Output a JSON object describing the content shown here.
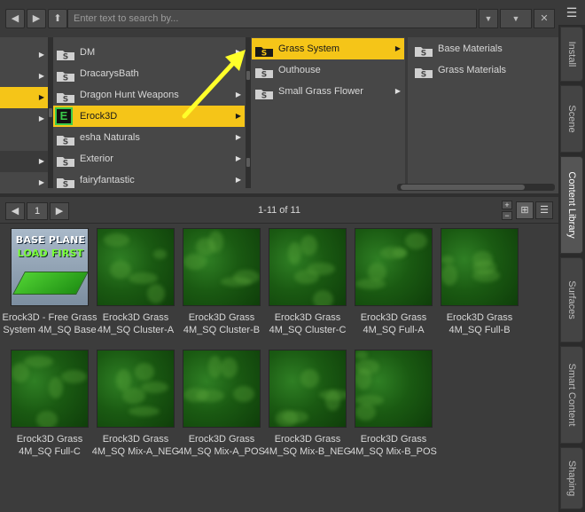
{
  "toolbar": {
    "back_icon": "arrow-left-icon",
    "forward_icon": "arrow-right-icon",
    "up_icon": "arrow-up-icon",
    "search_placeholder": "Enter text to search by...",
    "dropdown_icon": "chevron-down-icon",
    "clear_icon": "close-icon"
  },
  "browser": {
    "column2": [
      {
        "label": "DM",
        "has_children": true,
        "selected": false
      },
      {
        "label": "DracarysBath",
        "has_children": false,
        "selected": false
      },
      {
        "label": "Dragon Hunt Weapons",
        "has_children": true,
        "selected": false
      },
      {
        "label": "Erock3D",
        "has_children": true,
        "selected": true
      },
      {
        "label": "esha Naturals",
        "has_children": true,
        "selected": false
      },
      {
        "label": "Exterior",
        "has_children": true,
        "selected": false
      },
      {
        "label": "fairyfantastic",
        "has_children": true,
        "selected": false
      }
    ],
    "column3": [
      {
        "label": "Grass System",
        "has_children": true,
        "selected": true
      },
      {
        "label": "Outhouse",
        "has_children": false,
        "selected": false
      },
      {
        "label": "Small Grass Flower",
        "has_children": true,
        "selected": false
      }
    ],
    "column4": [
      {
        "label": "Base Materials"
      },
      {
        "label": "Grass Materials"
      }
    ]
  },
  "pager": {
    "page": "1",
    "count_text": "1-11 of 11"
  },
  "thumbnails": [
    {
      "label": "Erock3D - Free Grass System 4M_SQ Base",
      "kind": "base",
      "base_title": "BASE PLANE",
      "base_subtitle": "LOAD FIRST"
    },
    {
      "label": "Erock3D Grass 4M_SQ Cluster-A",
      "kind": "grass"
    },
    {
      "label": "Erock3D Grass 4M_SQ Cluster-B",
      "kind": "grass"
    },
    {
      "label": "Erock3D Grass 4M_SQ Cluster-C",
      "kind": "grass"
    },
    {
      "label": "Erock3D Grass 4M_SQ Full-A",
      "kind": "grass"
    },
    {
      "label": "Erock3D Grass 4M_SQ Full-B",
      "kind": "grass"
    },
    {
      "label": "Erock3D Grass 4M_SQ Full-C",
      "kind": "grass"
    },
    {
      "label": "Erock3D Grass 4M_SQ Mix-A_NEG",
      "kind": "grass"
    },
    {
      "label": "Erock3D Grass 4M_SQ Mix-A_POS",
      "kind": "grass"
    },
    {
      "label": "Erock3D Grass 4M_SQ Mix-B_NEG",
      "kind": "grass"
    },
    {
      "label": "Erock3D Grass 4M_SQ Mix-B_POS",
      "kind": "grass"
    }
  ],
  "side_tabs": [
    {
      "label": "Install",
      "active": false
    },
    {
      "label": "Scene",
      "active": false
    },
    {
      "label": "Content Library",
      "active": true
    },
    {
      "label": "Surfaces",
      "active": false
    },
    {
      "label": "Smart Content",
      "active": false
    },
    {
      "label": "Shaping",
      "active": false
    }
  ],
  "colors": {
    "selection": "#f5c518",
    "panel": "#474747",
    "background": "#3c3c3c",
    "annotation_arrow": "#ffff2a"
  }
}
